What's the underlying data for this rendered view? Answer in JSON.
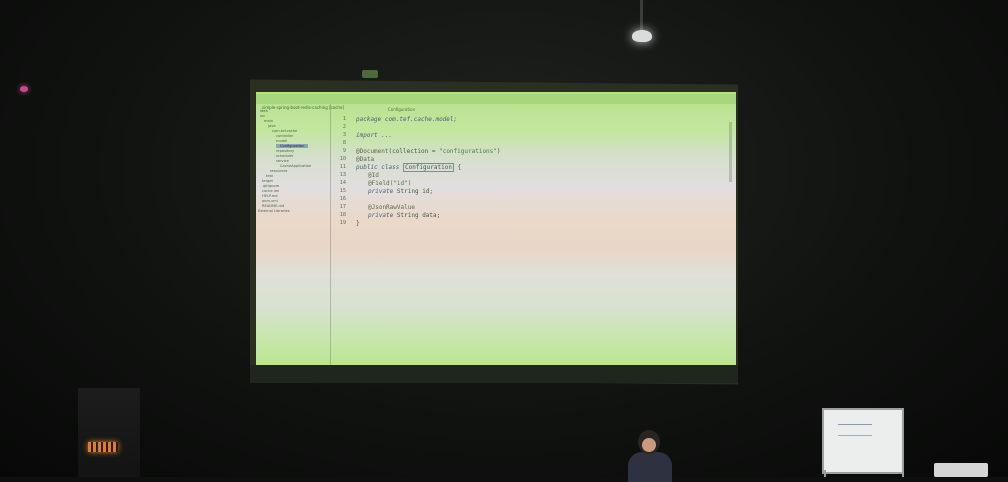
{
  "ide": {
    "tab_code": "Configuration",
    "project_title": "simple-spring-boot-redis-caching [cache]",
    "tree": [
      "idea",
      "src",
      "main",
      "java",
      "com.tef.cache",
      "controller",
      "model",
      "Configuration",
      "repository",
      "scheduler",
      "service",
      "CacheApplication",
      "resources",
      "test",
      "target",
      ".gitignore",
      "cache.iml",
      "HELP.md",
      "pom.xml",
      "README.md",
      "External Libraries",
      "Scratches and Consoles"
    ],
    "line_numbers": [
      "1",
      "2",
      "3",
      "8",
      "9",
      "10",
      "11",
      "13",
      "14",
      "15",
      "16",
      "17",
      "18",
      "19"
    ],
    "code": {
      "l1": "package com.tef.cache.model;",
      "l3": "import ...",
      "l9_anno": "@Document",
      "l9_args": "(collection = ",
      "l9_str": "\"configurations\"",
      "l9_close": ")",
      "l10": "@Data",
      "l11_kw": "public class ",
      "l11_name": "Configuration",
      "l11_brace": " {",
      "l13": "@Id",
      "l14_anno": "@Field",
      "l14_args": "(\"id\")",
      "l15_kw": "private ",
      "l15_rest": "String id;",
      "l17": "@JsonRawValue",
      "l18_kw": "private ",
      "l18_rest": "String data;",
      "l19": "}"
    }
  },
  "colors": {
    "projection_green": "#b3e28a",
    "stage_dark": "#0e0f0e"
  }
}
